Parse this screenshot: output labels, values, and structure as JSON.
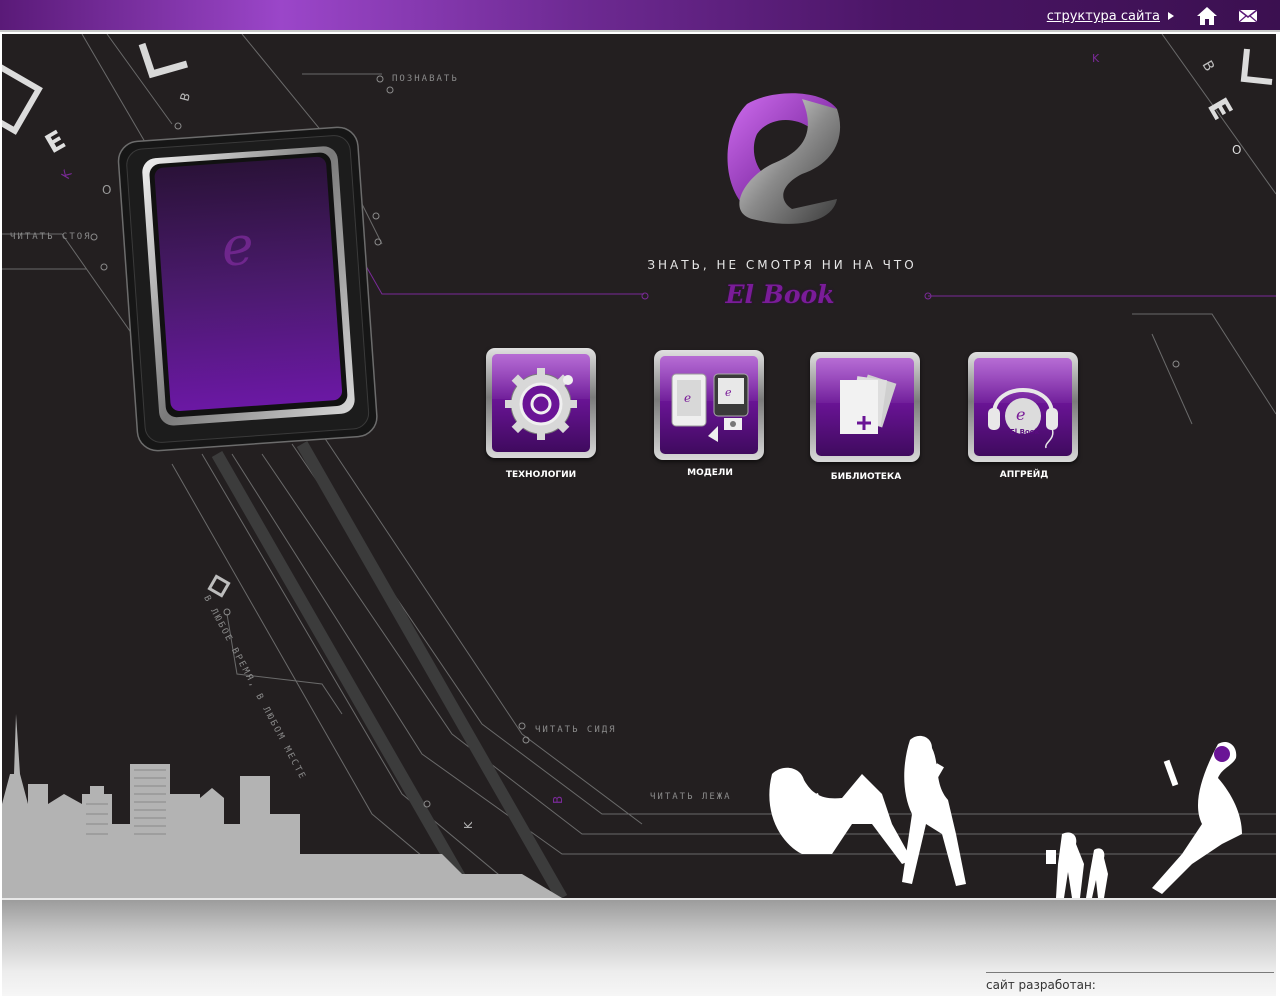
{
  "header": {
    "sitemap_label": "структура сайта"
  },
  "icons": {
    "home": "home-icon",
    "mail": "mail-icon"
  },
  "hero": {
    "tagline": "ЗНАТЬ, НЕ СМОТРЯ НИ НА ЧТО",
    "brand": "El Book"
  },
  "decorative_labels": {
    "learn": "ПОЗНАВАТЬ",
    "read_standing": "ЧИТАТЬ СТОЯ",
    "anytime": "В ЛЮБОЕ ВРЕМЯ, В ЛЮБОМ МЕСТЕ",
    "read_sitting": "ЧИТАТЬ СИДЯ",
    "read_lying": "ЧИТАТЬ ЛЕЖА"
  },
  "menu": [
    {
      "label": "ТЕХНОЛОГИИ",
      "icon": "gear-icon"
    },
    {
      "label": "МОДЕЛИ",
      "icon": "ebook-devices-icon"
    },
    {
      "label": "БИБЛИОТЕКА",
      "icon": "library-pages-icon"
    },
    {
      "label": "АПГРЕЙД",
      "icon": "headphones-icon"
    }
  ],
  "footer": {
    "developer_label": "сайт разработан:"
  },
  "colors": {
    "accent": "#7a1c98",
    "background": "#231f20",
    "topbar": "#6e2a93"
  }
}
